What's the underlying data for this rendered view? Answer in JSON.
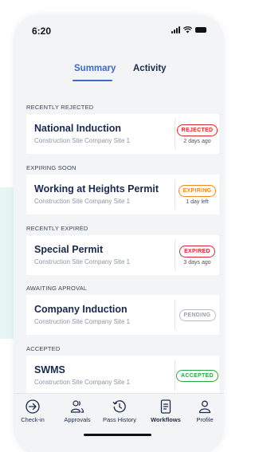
{
  "status_bar": {
    "time": "6:20"
  },
  "tabs": {
    "summary": "Summary",
    "activity": "Activity"
  },
  "sections": {
    "recently_rejected": {
      "header": "RECENTLY REJECTED",
      "card": {
        "title": "National Induction",
        "subtitle": "Construction Site Company Site 1",
        "badge": "REJECTED",
        "badge_sub": "2 days ago"
      }
    },
    "expiring_soon": {
      "header": "EXPIRING SOON",
      "card": {
        "title": "Working at Heights Permit",
        "subtitle": "Construction Site Company Site 1",
        "badge": "EXPIRING",
        "badge_sub": "1 day left"
      }
    },
    "recently_expired": {
      "header": "RECENTLY EXPIRED",
      "card": {
        "title": "Special Permit",
        "subtitle": "Construction Site Company Site 1",
        "badge": "EXPIRED",
        "badge_sub": "3 days ago"
      }
    },
    "awaiting_approval": {
      "header": "AWAITING APROVAL",
      "card": {
        "title": "Company Induction",
        "subtitle": "Construction Site Company Site 1",
        "badge": "PENDING"
      }
    },
    "accepted": {
      "header": "ACCEPTED",
      "card": {
        "title": "SWMS",
        "subtitle": "Construction Site Company Site 1",
        "badge": "ACCEPTED"
      }
    }
  },
  "bottom_nav": {
    "checkin": "Check-in",
    "approvals": "Approvals",
    "pass_history": "Pass History",
    "workflows": "Workflows",
    "profile": "Profile"
  },
  "colors": {
    "accent": "#3d69c8",
    "rejected": "#d8282f",
    "expiring": "#ef8a26",
    "pending": "#9aa0aa",
    "accepted": "#2aa846"
  },
  "icons": [
    "signal-icon",
    "wifi-icon",
    "battery-icon",
    "check-in-arrow-icon",
    "approvals-users-icon",
    "pass-history-clock-icon",
    "workflows-document-icon",
    "profile-person-icon"
  ]
}
